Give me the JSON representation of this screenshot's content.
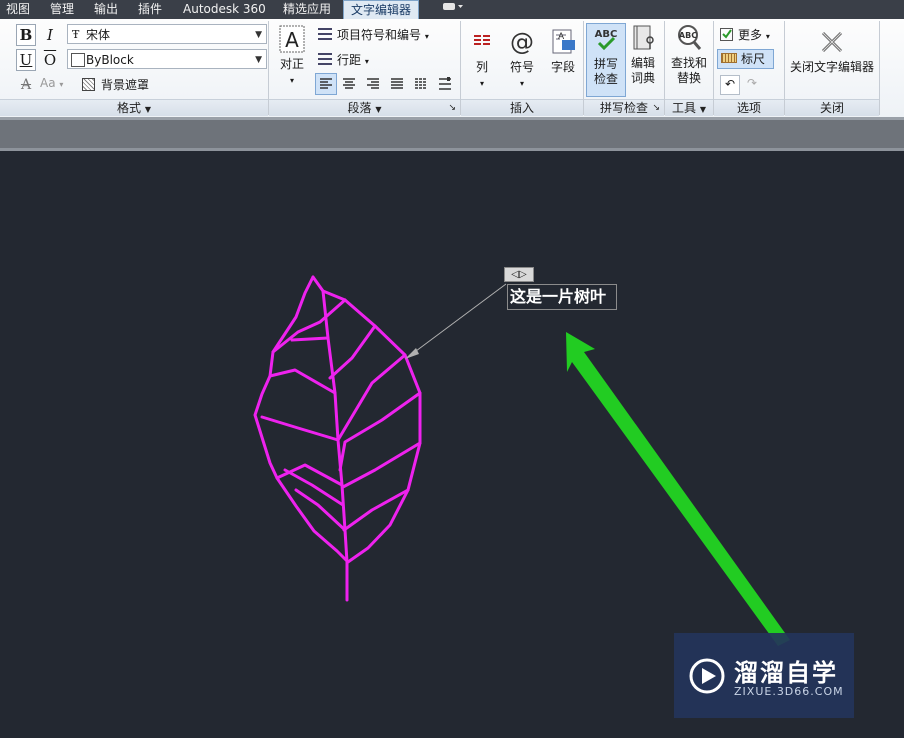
{
  "tabs": [
    "视图",
    "管理",
    "输出",
    "插件",
    "Autodesk 360",
    "精选应用",
    "文字编辑器"
  ],
  "active_tab": "文字编辑器",
  "format_panel": {
    "bold": "B",
    "italic": "I",
    "underline": "U",
    "overline": "O",
    "font_value": "宋体",
    "color_value": "ByBlock",
    "strike": "A",
    "case": "Aa",
    "background_mask": "背景遮罩",
    "caption": "格式"
  },
  "paragraph_panel": {
    "justify": "对正",
    "bullets": "项目符号和编号",
    "line_spacing": "行距",
    "caption": "段落"
  },
  "insert_panel": {
    "columns": "列",
    "symbol": "符号",
    "field": "字段",
    "caption": "插入"
  },
  "spell_panel": {
    "spell_check_1": "拼写",
    "spell_check_2": "检查",
    "edit_dict_1": "编辑",
    "edit_dict_2": "词典",
    "caption": "拼写检查"
  },
  "tools_panel": {
    "find_1": "查找和",
    "find_2": "替换",
    "caption": "工具"
  },
  "options_panel": {
    "more": "更多",
    "ruler": "标尺",
    "caption": "选项"
  },
  "close_panel": {
    "close_label": "关闭文字编辑器",
    "caption": "关闭"
  },
  "drawing": {
    "text": "这是一片树叶",
    "grip": "◁▷",
    "leaf_color": "#ee22ee",
    "arrow_color": "#22cc22"
  },
  "watermark": {
    "brand": "溜溜自学",
    "url": "ZIXUE.3D66.COM"
  }
}
